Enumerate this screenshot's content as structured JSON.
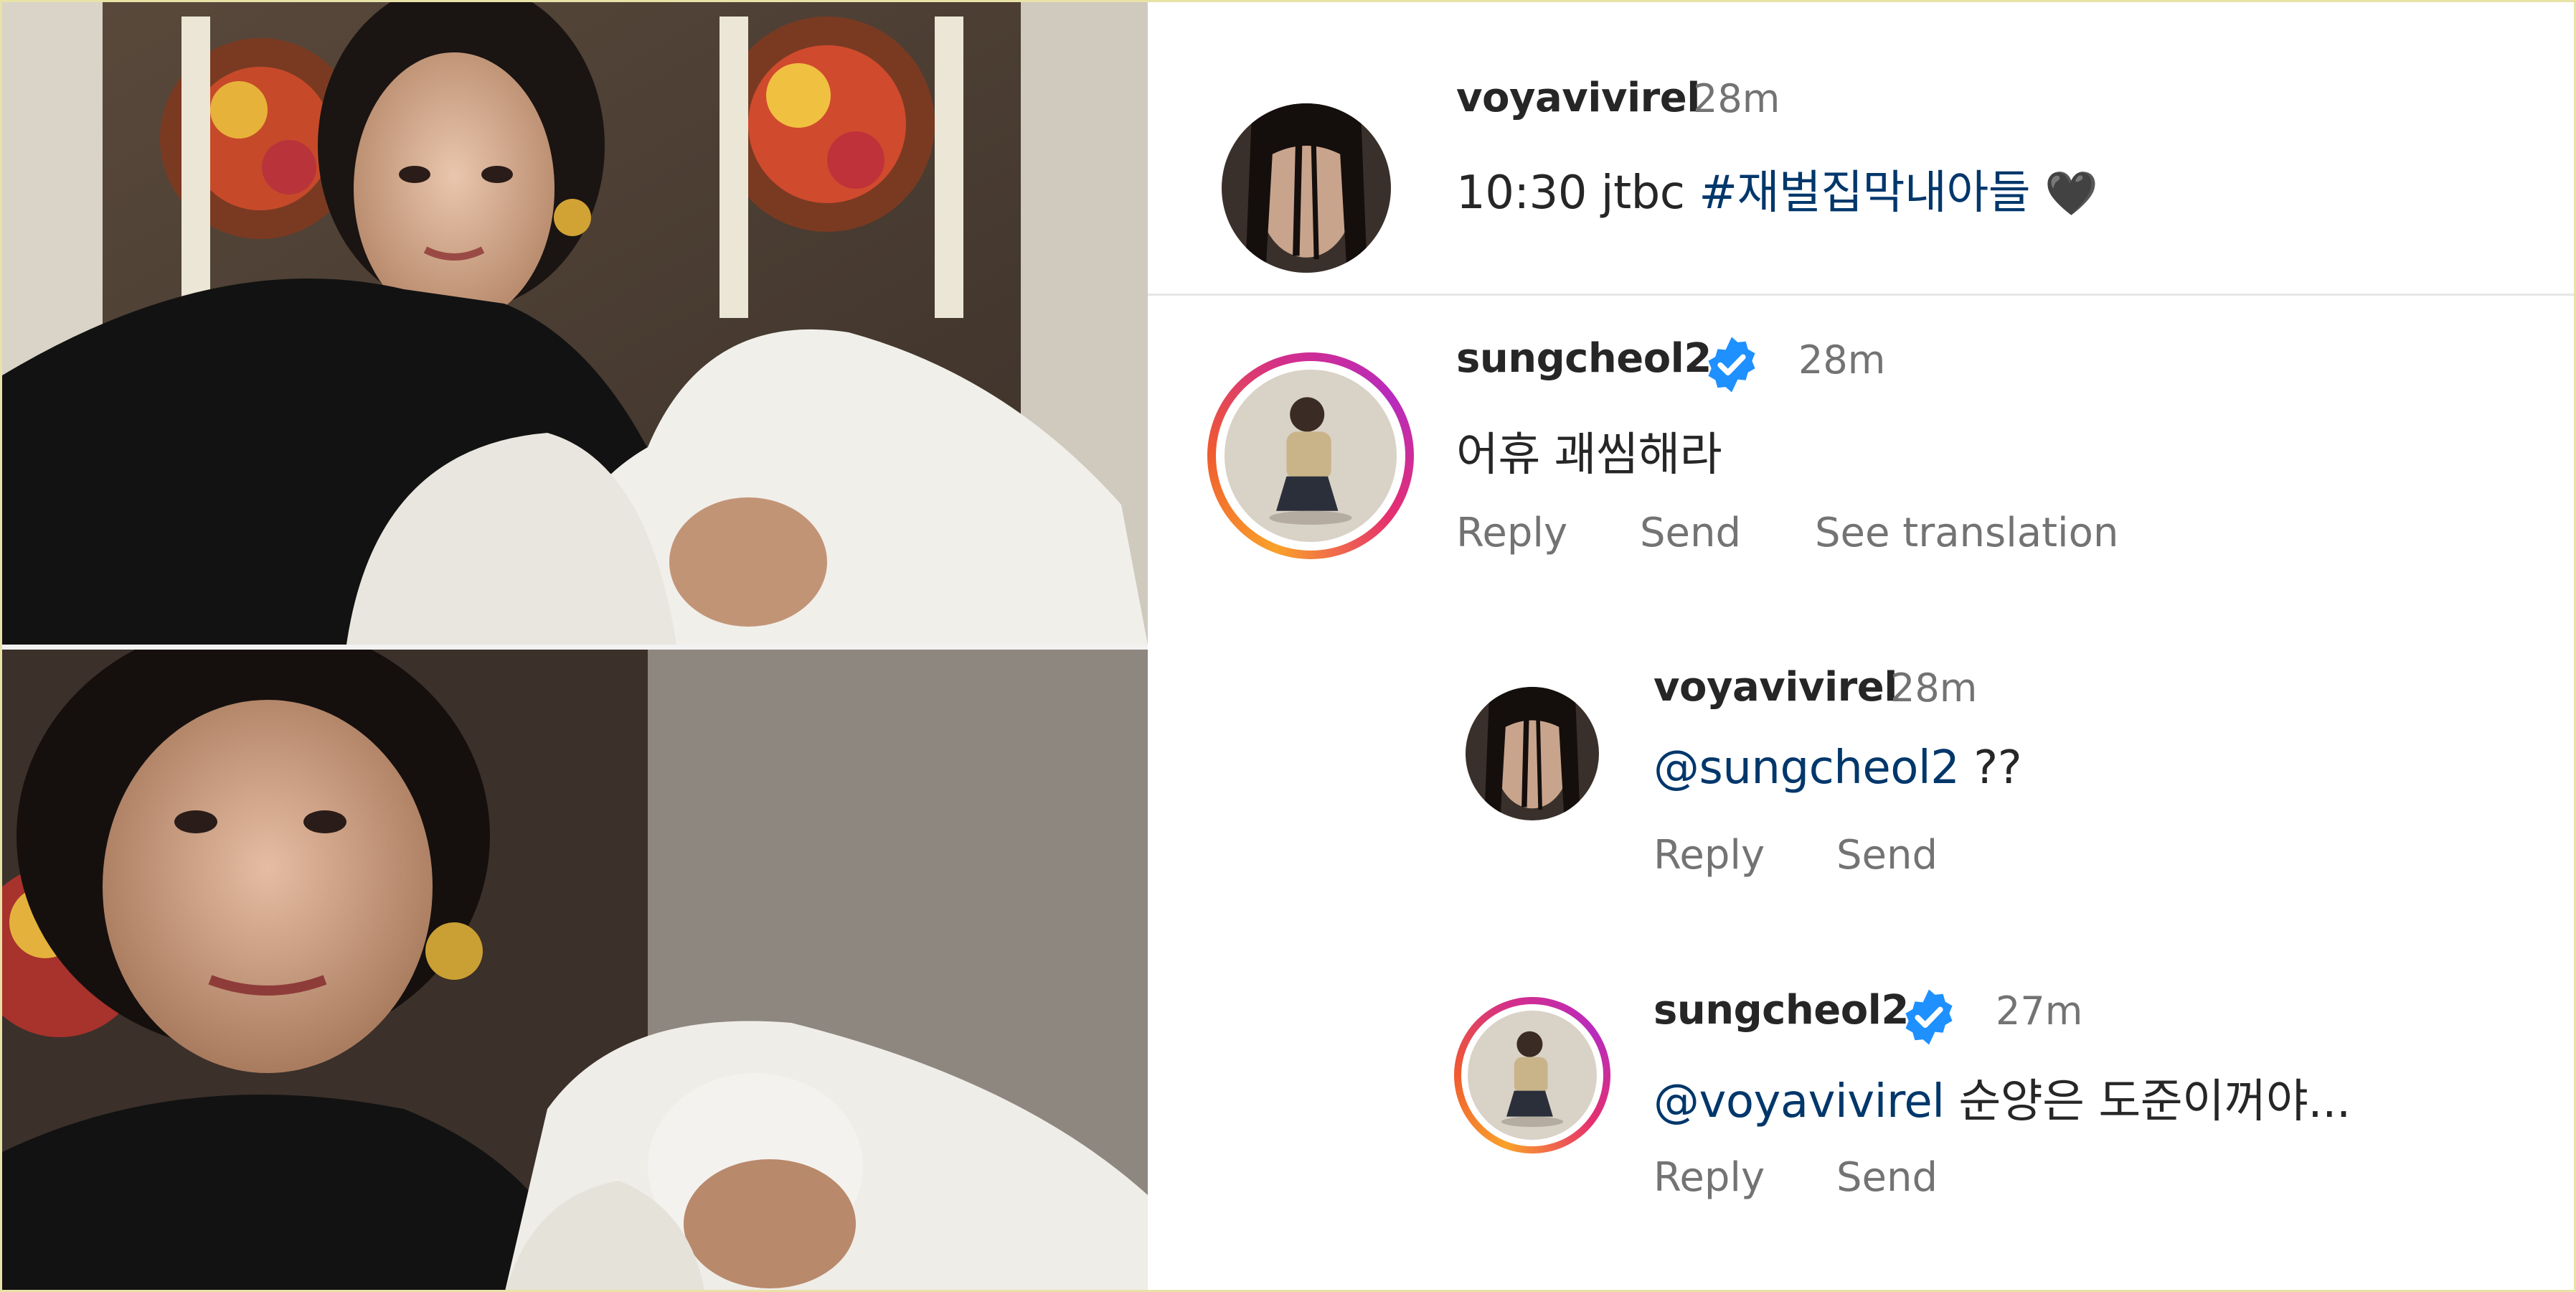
{
  "post": {
    "username": "voyavivirel",
    "time": "28m",
    "caption_text": "10:30 jtbc ",
    "caption_hashtag": "#재벌집막내아들",
    "caption_emoji": "🖤"
  },
  "comments": [
    {
      "username": "sungcheol2",
      "verified": true,
      "time": "28m",
      "text": "어휴 괘씸해라",
      "actions": [
        "Reply",
        "Send",
        "See translation"
      ]
    }
  ],
  "replies": [
    {
      "username": "voyavivirel",
      "time": "28m",
      "mention": "@sungcheol2",
      "text": " ??",
      "actions": [
        "Reply",
        "Send"
      ]
    },
    {
      "username": "sungcheol2",
      "verified": true,
      "time": "27m",
      "mention": "@voyavivirel",
      "text": " 순양은 도준이꺼야...",
      "actions": [
        "Reply",
        "Send"
      ]
    }
  ],
  "colors": {
    "mention": "#00376b",
    "verified_badge": "#1e90ff",
    "story_ring": [
      "#f9a12a",
      "#d32e8c",
      "#b82bbd"
    ],
    "secondary_text": "#737373"
  },
  "icons": [
    "verified-badge-icon",
    "black-heart-icon"
  ]
}
